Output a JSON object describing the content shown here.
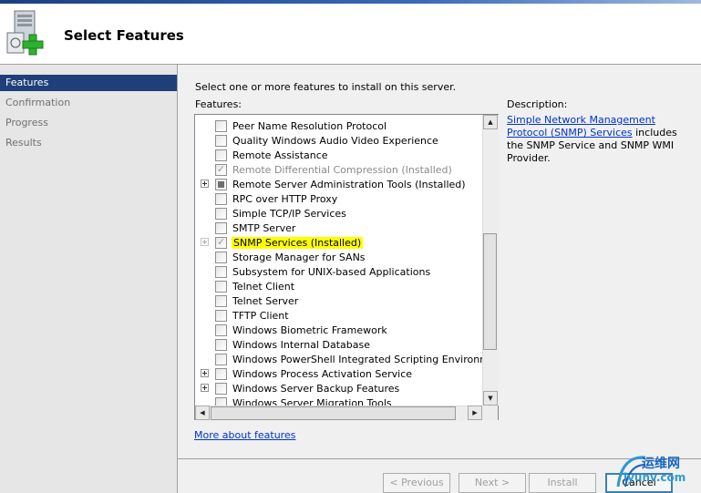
{
  "header": {
    "title": "Select Features",
    "icon": "server-add-icon"
  },
  "nav": {
    "items": [
      {
        "label": "Features",
        "active": true
      },
      {
        "label": "Confirmation",
        "active": false
      },
      {
        "label": "Progress",
        "active": false
      },
      {
        "label": "Results",
        "active": false
      }
    ]
  },
  "main": {
    "instruction": "Select one or more features to install on this server.",
    "features_label": "Features:",
    "description_label": "Description:",
    "description_link": "Simple Network Management Protocol (SNMP) Services",
    "description_text": " includes the SNMP Service and SNMP WMI Provider.",
    "more_link": "More about features"
  },
  "features": [
    {
      "label": "Peer Name Resolution Protocol",
      "state": "unchecked",
      "expander": false
    },
    {
      "label": "Quality Windows Audio Video Experience",
      "state": "unchecked",
      "expander": false
    },
    {
      "label": "Remote Assistance",
      "state": "unchecked",
      "expander": false
    },
    {
      "label": "Remote Differential Compression  (Installed)",
      "state": "checked",
      "expander": false,
      "dim": true
    },
    {
      "label": "Remote Server Administration Tools  (Installed)",
      "state": "partial",
      "expander": true
    },
    {
      "label": "RPC over HTTP Proxy",
      "state": "unchecked",
      "expander": false
    },
    {
      "label": "Simple TCP/IP Services",
      "state": "unchecked",
      "expander": false
    },
    {
      "label": "SMTP Server",
      "state": "unchecked",
      "expander": false
    },
    {
      "label": "SNMP Services  (Installed)",
      "state": "checked",
      "expander": true,
      "expander_disabled": true,
      "highlight": true
    },
    {
      "label": "Storage Manager for SANs",
      "state": "unchecked",
      "expander": false
    },
    {
      "label": "Subsystem for UNIX-based Applications",
      "state": "unchecked",
      "expander": false
    },
    {
      "label": "Telnet Client",
      "state": "unchecked",
      "expander": false
    },
    {
      "label": "Telnet Server",
      "state": "unchecked",
      "expander": false
    },
    {
      "label": "TFTP Client",
      "state": "unchecked",
      "expander": false
    },
    {
      "label": "Windows Biometric Framework",
      "state": "unchecked",
      "expander": false
    },
    {
      "label": "Windows Internal Database",
      "state": "unchecked",
      "expander": false
    },
    {
      "label": "Windows PowerShell Integrated Scripting Environment (IS",
      "state": "unchecked",
      "expander": false
    },
    {
      "label": "Windows Process Activation Service",
      "state": "unchecked",
      "expander": true
    },
    {
      "label": "Windows Server Backup Features",
      "state": "unchecked",
      "expander": true
    },
    {
      "label": "Windows Server Migration Tools",
      "state": "unchecked",
      "expander": false
    }
  ],
  "buttons": {
    "previous": "< Previous",
    "next": "Next >",
    "install": "Install",
    "cancel": "Cancel"
  },
  "watermark": {
    "line1": "运维网",
    "line2": "iyunv.com"
  }
}
